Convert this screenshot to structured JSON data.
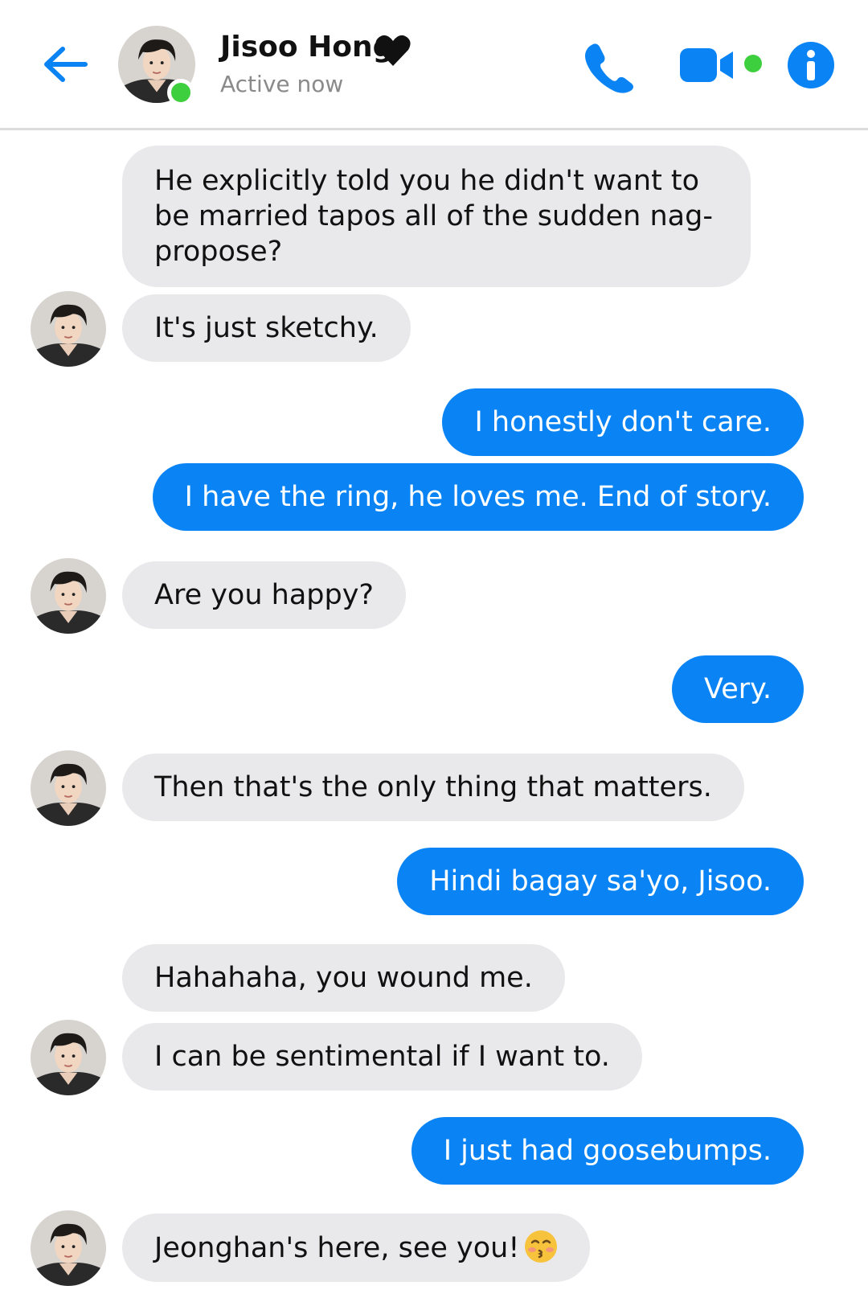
{
  "header": {
    "contact_name": "Jisoo Hong",
    "status": "Active now",
    "accent_color": "#0a84f5",
    "online_color": "#3ecf3e",
    "icons": [
      "back-arrow-icon",
      "heart-icon",
      "phone-icon",
      "video-camera-icon",
      "info-icon"
    ]
  },
  "messages": [
    {
      "from": "contact",
      "text": "He explicitly told you he didn't want to be married tapos all of the sudden nag-propose?"
    },
    {
      "from": "contact",
      "text": "It's just sketchy."
    },
    {
      "from": "me",
      "text": "I honestly don't care."
    },
    {
      "from": "me",
      "text": "I have the ring, he loves me. End of story."
    },
    {
      "from": "contact",
      "text": "Are you happy?"
    },
    {
      "from": "me",
      "text": "Very."
    },
    {
      "from": "contact",
      "text": "Then that's the only thing that matters."
    },
    {
      "from": "me",
      "text": "Hindi bagay sa'yo, Jisoo."
    },
    {
      "from": "contact",
      "text": "Hahahaha, you wound me."
    },
    {
      "from": "contact",
      "text": "I can be sentimental if I want to."
    },
    {
      "from": "me",
      "text": "I just had goosebumps."
    },
    {
      "from": "contact",
      "text": "Jeonghan's here, see you!",
      "emoji": "kissing-face-emoji"
    }
  ],
  "colors": {
    "sent_bubble": "#0a84f5",
    "received_bubble": "#e9e9eb"
  }
}
